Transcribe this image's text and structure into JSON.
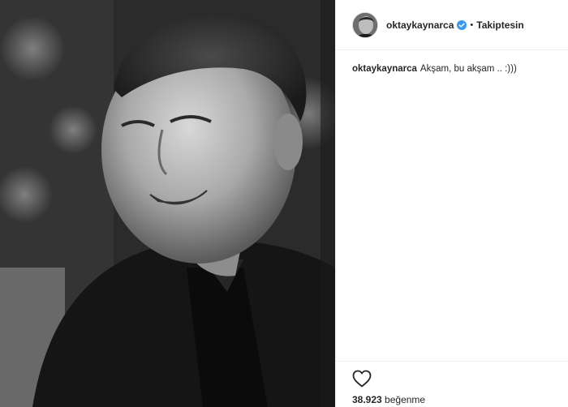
{
  "post": {
    "photo": {
      "alt": "black and white portrait photo of a smiling man"
    },
    "header": {
      "username": "oktaykaynarca",
      "verified_icon": "verified-badge-icon",
      "separator": "•",
      "follow_status": "Takiptesin"
    },
    "caption": {
      "username": "oktaykaynarca",
      "text": "Akşam, bu akşam .. :)))"
    },
    "actions": {
      "like_icon": "heart-outline-icon"
    },
    "likes": {
      "count": "38.923",
      "label": "beğenme"
    }
  },
  "colors": {
    "text": "#262626",
    "border": "#efefef",
    "verified": "#3897f0"
  }
}
